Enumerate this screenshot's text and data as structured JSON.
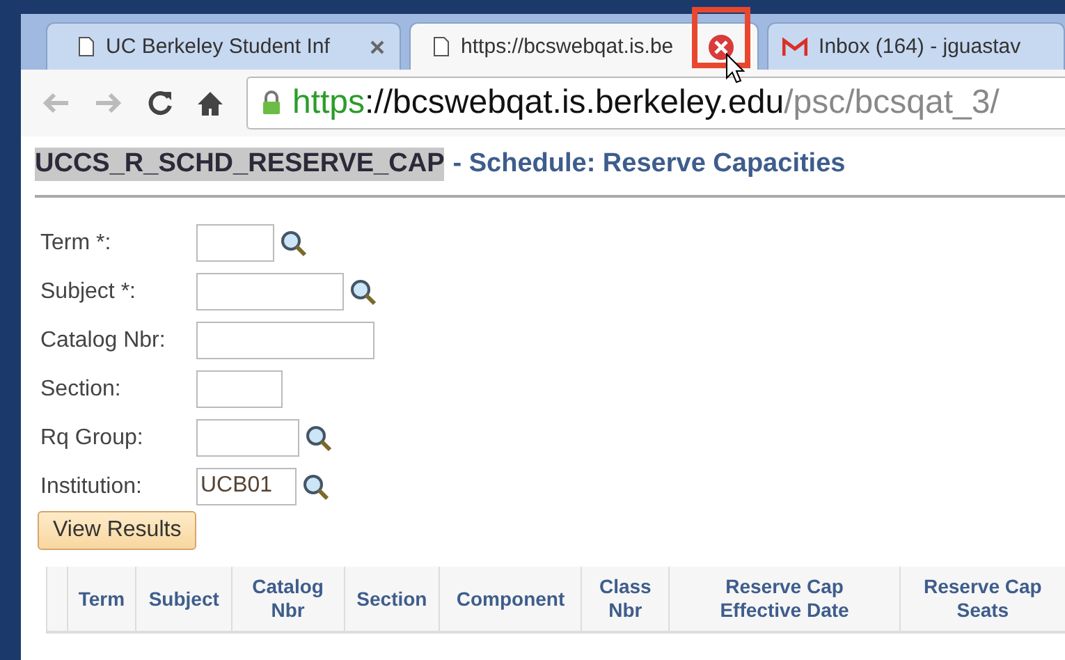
{
  "tabs": [
    {
      "title": "UC Berkeley Student Inf",
      "selected": false,
      "kind": "page"
    },
    {
      "title": "https://bcswebqat.is.be",
      "selected": true,
      "kind": "page"
    },
    {
      "title": "Inbox (164) - jguastav",
      "selected": false,
      "kind": "mail"
    }
  ],
  "address_bar": {
    "scheme": "https",
    "host": "://bcswebqat.is.berkeley.edu",
    "path": "/psc/bcsqat_3/"
  },
  "page": {
    "component": "UCCS_R_SCHD_RESERVE_CAP",
    "title": "- Schedule: Reserve Capacities"
  },
  "fields": [
    {
      "label": "Term *:",
      "kind": "lookup"
    },
    {
      "label": "Subject *:",
      "kind": "lookup"
    },
    {
      "label": "Catalog Nbr:",
      "kind": "plain"
    },
    {
      "label": "Section:",
      "kind": "plain"
    },
    {
      "label": "Rq Group:",
      "kind": "lookup"
    },
    {
      "label": "Institution:",
      "kind": "lookup",
      "value": "UCB01"
    }
  ],
  "button": "View Results",
  "table": {
    "columns": [
      "Term",
      "Subject",
      "Catalog\nNbr",
      "Section",
      "Component",
      "Class\nNbr",
      "Reserve Cap\nEffective Date",
      "Reserve Cap\nSeats"
    ]
  }
}
